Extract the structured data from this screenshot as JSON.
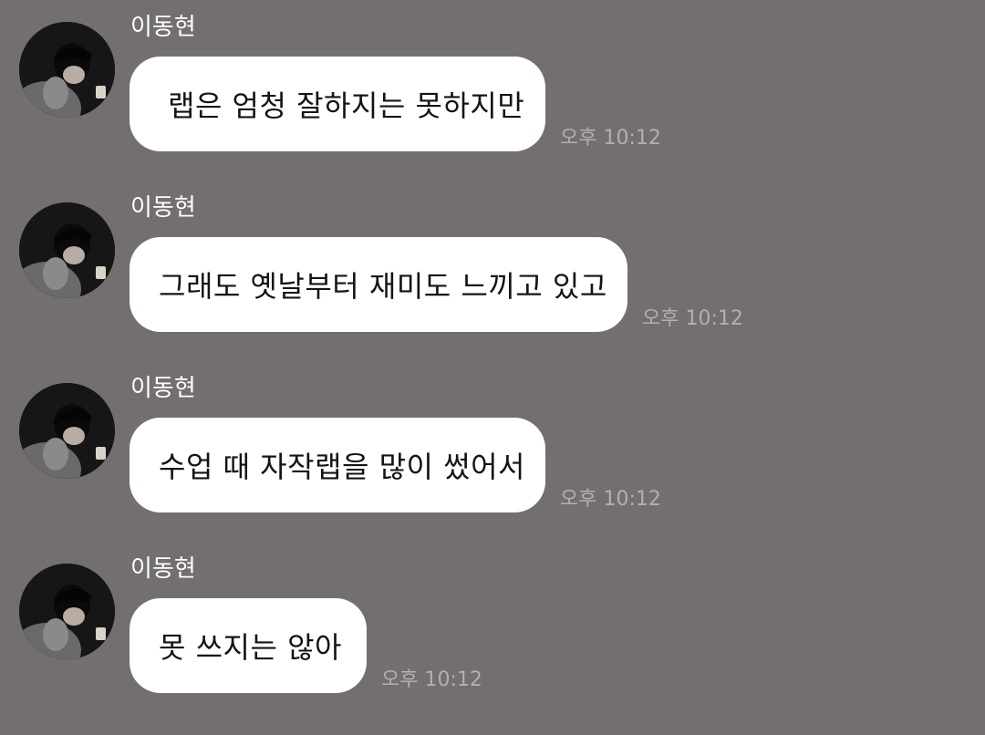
{
  "messages": [
    {
      "sender": "이동현",
      "text": "랩은 엄청 잘하지는 못하지만",
      "time": "오후 10:12"
    },
    {
      "sender": "이동현",
      "text": "그래도 옛날부터 재미도 느끼고 있고",
      "time": "오후 10:12"
    },
    {
      "sender": "이동현",
      "text": "수업 때 자작랩을 많이 썼어서",
      "time": "오후 10:12"
    },
    {
      "sender": "이동현",
      "text": "못 쓰지는 않아",
      "time": "오후 10:12"
    }
  ],
  "colors": {
    "background": "#736f6f",
    "bubble": "#ffffff",
    "sender_text": "#ffffff",
    "message_text": "#141414",
    "timestamp": "#b4afaf"
  }
}
